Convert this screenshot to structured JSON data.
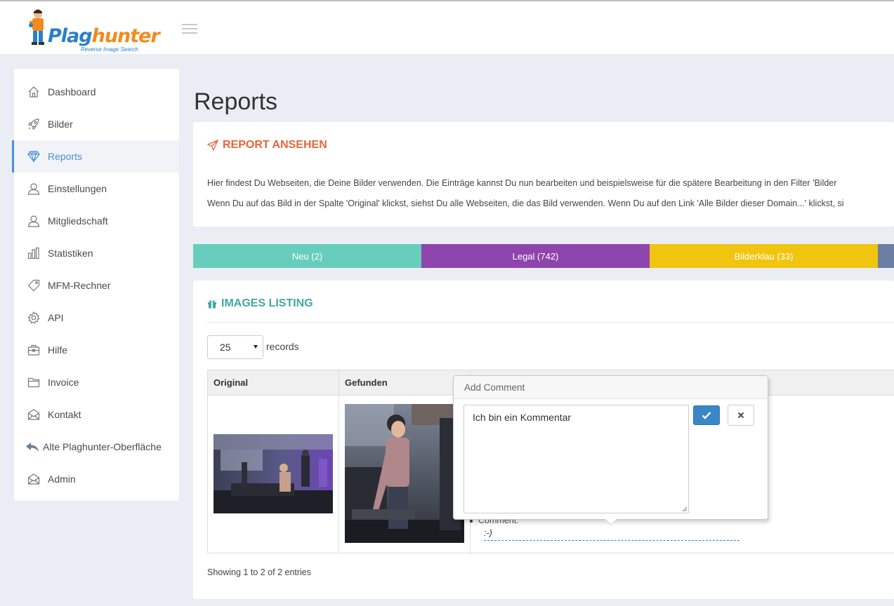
{
  "logo": {
    "brand_part1": "Plag",
    "brand_part2": "hunter",
    "tagline": "Reverse Image Search"
  },
  "sidebar": {
    "items": [
      {
        "label": "Dashboard",
        "icon": "home-icon"
      },
      {
        "label": "Bilder",
        "icon": "rocket-icon"
      },
      {
        "label": "Reports",
        "icon": "diamond-icon",
        "active": true
      },
      {
        "label": "Einstellungen",
        "icon": "user-icon"
      },
      {
        "label": "Mitgliedschaft",
        "icon": "user-icon"
      },
      {
        "label": "Statistiken",
        "icon": "bar-chart-icon"
      },
      {
        "label": "MFM-Rechner",
        "icon": "tag-icon"
      },
      {
        "label": "API",
        "icon": "gear-icon"
      },
      {
        "label": "Hilfe",
        "icon": "briefcase-icon"
      },
      {
        "label": "Invoice",
        "icon": "folder-icon"
      },
      {
        "label": "Kontakt",
        "icon": "envelope-icon"
      },
      {
        "label": "Alte Plaghunter-Oberfläche",
        "icon": "reply-icon"
      },
      {
        "label": "Admin",
        "icon": "envelope-icon"
      }
    ]
  },
  "page": {
    "title": "Reports"
  },
  "report_panel": {
    "heading": "REPORT ANSEHEN",
    "line1": "Hier findest Du Webseiten, die Deine Bilder verwenden. Die Einträge kannst Du nun bearbeiten und beispielsweise für die spätere Bearbeitung in den Filter 'Bilder",
    "line2": "Wenn Du auf das Bild in der Spalte 'Original' klickst, siehst Du alle Webseiten, die das Bild verwenden. Wenn Du auf den Link 'Alle Bilder dieser Domain...' klickst, si"
  },
  "tabs": [
    {
      "label": "Neu (2)",
      "color": "#67cdbc"
    },
    {
      "label": "Legal (742)",
      "color": "#8e44ad"
    },
    {
      "label": "Bilderklau (33)",
      "color": "#f1c40f"
    },
    {
      "label": "",
      "color": "#6b7fa3"
    }
  ],
  "listing": {
    "heading": "IMAGES LISTING",
    "records_value": "25",
    "records_label": "records",
    "columns": [
      "Original",
      "Gefunden"
    ],
    "comment_label": "Comment:",
    "comment_value": ":-)",
    "showing": "Showing 1 to 2 of 2 entries"
  },
  "popover": {
    "title": "Add Comment",
    "textarea_value": "Ich bin ein Kommentar"
  },
  "colors": {
    "accent": "#4a90d9",
    "report_heading": "#e8663b",
    "listing_heading": "#41a9a0",
    "ok_button": "#3a86c8"
  }
}
